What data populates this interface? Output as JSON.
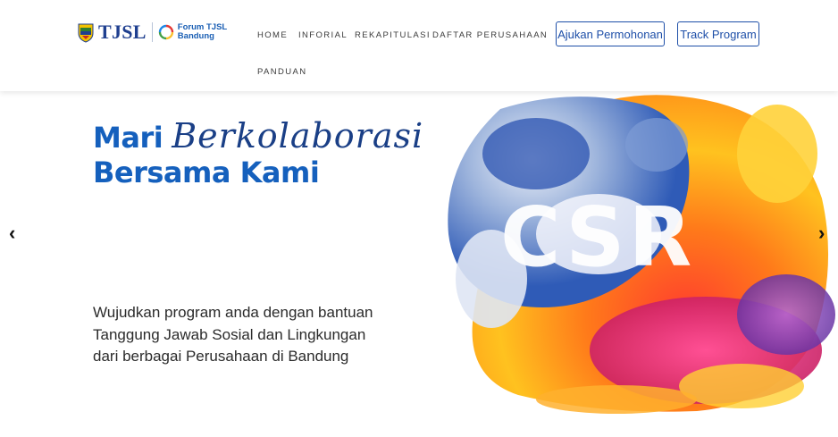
{
  "brand": {
    "logo_text": "TJSL",
    "forum_line1": "Forum TJSL",
    "forum_line2": "Bandung",
    "primary_color": "#1e4fa8"
  },
  "nav": {
    "items": [
      {
        "label": "HOME"
      },
      {
        "label": "INFORIAL"
      },
      {
        "label": "REKAPITULASI"
      },
      {
        "label": "DAFTAR PERUSAHAAN"
      },
      {
        "label": "PANDUAN"
      }
    ],
    "apply_button": "Ajukan Permohonan",
    "track_button": "Track Program"
  },
  "hero": {
    "title_word1": "Mari",
    "title_script": "Berkolaborasi",
    "title_line2": "Bersama Kami",
    "desc_lines": [
      "Wujudkan program anda dengan bantuan",
      "Tanggung Jawab Sosial dan Lingkungan",
      "dari berbagai Perusahaan di Bandung"
    ],
    "art_text": "CSR",
    "prev_arrow": "‹",
    "next_arrow": "›"
  }
}
